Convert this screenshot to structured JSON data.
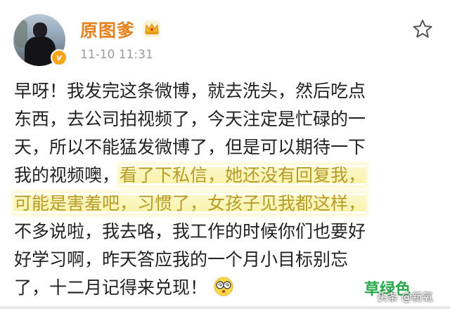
{
  "post": {
    "user_name": "原图爹",
    "time": "11-10 11:31",
    "lines": [
      [
        "早呀！我发完这条微博，就去洗头，然后吃点"
      ],
      [
        "东西，去公司拍视频了，今天注定是忙碌的一"
      ],
      [
        "天，所以不能猛发微博了，但是可以期待一下"
      ],
      [
        "我的视频噢，",
        "看了下私信，她还没有回复我，"
      ],
      [
        "可能是害羞吧，习惯了，女孩子见我都这样，"
      ],
      [
        "不多说啦，我去咯，我工作的时候你们也要好"
      ],
      [
        "好学习啊，昨天答应我的一个月小目标别忘"
      ],
      [
        "了，十二月记得来兑现！"
      ]
    ]
  },
  "icons": {
    "avatar": "avatar-photo",
    "verify": "verified-badge-icon",
    "crown": "crown-vip-icon",
    "star": "star-outline-icon",
    "emoji": "dizzy-face-emoji-icon"
  },
  "watermark": {
    "primary": "草绿色",
    "secondary": "头条 @新氧"
  },
  "colors": {
    "user_name": "#e5821e",
    "highlight_text": "#b69c2a",
    "highlight_bg": "#f9f3ad",
    "watermark_green": "#29a84a"
  }
}
